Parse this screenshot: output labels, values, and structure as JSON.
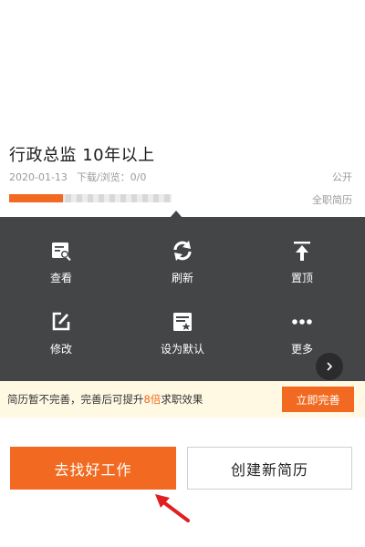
{
  "resume": {
    "title": "行政总监 10年以上",
    "date": "2020-01-13",
    "stats": "下载/浏览：0/0",
    "visibility": "公开",
    "type": "全职简历",
    "completeness": 0.33
  },
  "menu": {
    "items": [
      {
        "label": "查看",
        "icon": "view-icon"
      },
      {
        "label": "刷新",
        "icon": "refresh-icon"
      },
      {
        "label": "置顶",
        "icon": "pin-top-icon"
      },
      {
        "label": "修改",
        "icon": "edit-icon"
      },
      {
        "label": "设为默认",
        "icon": "set-default-icon"
      },
      {
        "label": "更多",
        "icon": "more-icon"
      }
    ]
  },
  "notice": {
    "text_before": "简历暂不完善，完善后可提升",
    "highlight": "8倍",
    "text_after": "求职效果",
    "button": "立即完善"
  },
  "actions": {
    "find_job": "去找好工作",
    "create_resume": "创建新简历"
  },
  "colors": {
    "accent": "#f26a21",
    "menu_bg": "#444547",
    "notice_bg": "#fff8e3"
  }
}
